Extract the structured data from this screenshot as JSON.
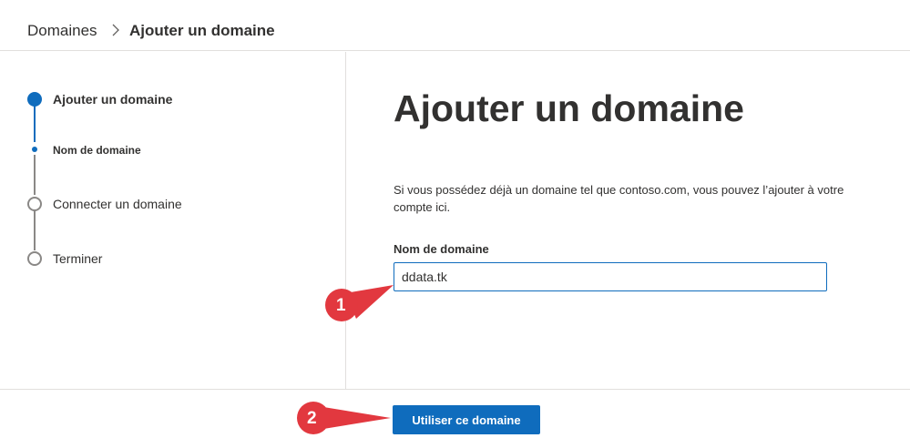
{
  "breadcrumb": {
    "root": "Domaines",
    "current": "Ajouter un domaine"
  },
  "stepper": {
    "steps": [
      {
        "label": "Ajouter un domaine",
        "state": "current"
      },
      {
        "label": "Nom de domaine",
        "state": "current-substep"
      },
      {
        "label": "Connecter un domaine",
        "state": "pending"
      },
      {
        "label": "Terminer",
        "state": "pending"
      }
    ]
  },
  "main": {
    "title": "Ajouter un domaine",
    "description": "Si vous possédez déjà un domaine tel que contoso.com, vous pouvez l’ajouter à votre compte ici.",
    "field_label": "Nom de domaine",
    "field_value": "ddata.tk"
  },
  "footer": {
    "primary_label": "Utiliser ce domaine"
  },
  "annotations": {
    "callout_1": "1",
    "callout_2": "2"
  },
  "colors": {
    "accent": "#0f6cbd",
    "callout": "#e2383f"
  },
  "icons": {
    "breadcrumb_separator": "chevron-right-icon"
  }
}
